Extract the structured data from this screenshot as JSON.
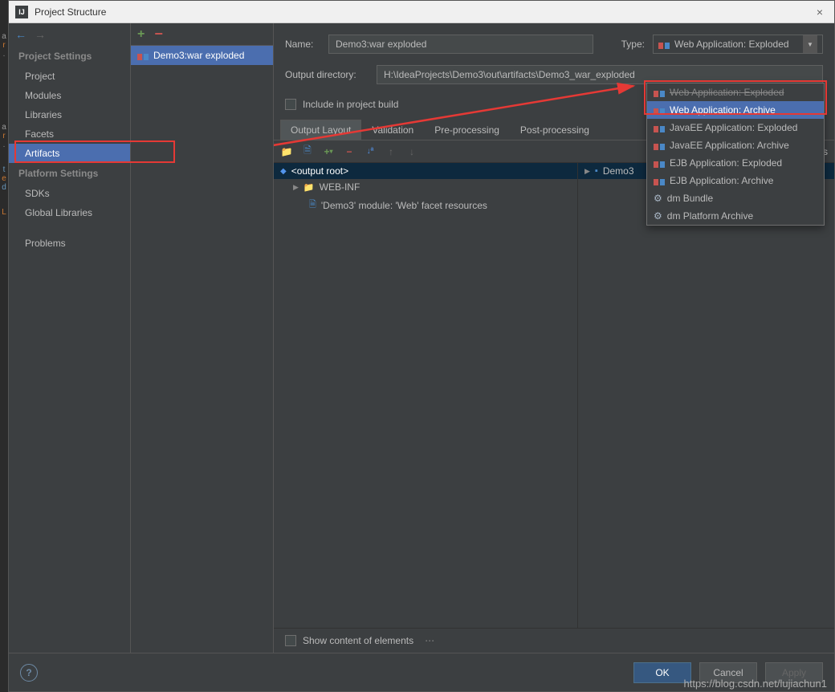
{
  "window": {
    "title": "Project Structure"
  },
  "sidebar": {
    "project_settings_header": "Project Settings",
    "project": "Project",
    "modules": "Modules",
    "libraries": "Libraries",
    "facets": "Facets",
    "artifacts": "Artifacts",
    "platform_settings_header": "Platform Settings",
    "sdks": "SDKs",
    "global_libraries": "Global Libraries",
    "problems": "Problems"
  },
  "artifact_list": {
    "item0": "Demo3:war exploded"
  },
  "form": {
    "name_label": "Name:",
    "name_value": "Demo3:war exploded",
    "type_label": "Type:",
    "type_value": "Web Application: Exploded",
    "outdir_label": "Output directory:",
    "outdir_value": "H:\\IdeaProjects\\Demo3\\out\\artifacts\\Demo3_war_exploded",
    "include_label": "Include in project build"
  },
  "tabs": {
    "t0": "Output Layout",
    "t1": "Validation",
    "t2": "Pre-processing",
    "t3": "Post-processing"
  },
  "layout": {
    "available_label": "Available Elements",
    "output_root": "<output root>",
    "webinf": "WEB-INF",
    "module_resources": "'Demo3' module: 'Web' facet resources",
    "avail_demo3": "Demo3"
  },
  "dropdown": {
    "i0": "Web Application: Exploded",
    "i1": "Web Application: Archive",
    "i2": "JavaEE Application: Exploded",
    "i3": "JavaEE Application: Archive",
    "i4": "EJB Application: Exploded",
    "i5": "EJB Application: Archive",
    "i6": "dm Bundle",
    "i7": "dm Platform Archive"
  },
  "bottom": {
    "show_content": "Show content of elements"
  },
  "footer": {
    "ok": "OK",
    "cancel": "Cancel",
    "apply": "Apply"
  },
  "watermark": "https://blog.csdn.net/lujiachun1"
}
